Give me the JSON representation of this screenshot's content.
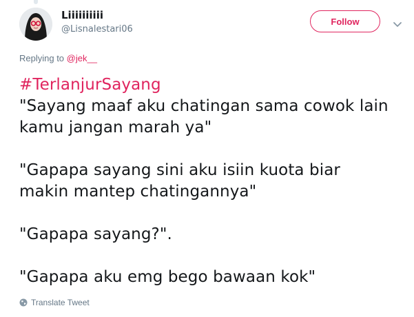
{
  "tweet": {
    "display_name": "Liiiiiiiiii",
    "screen_name": "@Lisnalestari06",
    "follow_label": "Follow",
    "replying_prefix": "Replying to",
    "replying_to": "@jek__",
    "hashtag": "#TerlanjurSayang",
    "lines": [
      "\"Sayang maaf aku chatingan sama cowok lain",
      "kamu jangan marah ya\"",
      "\"Gapapa sayang sini aku isiin kuota biar",
      "makin mantep chatingannya\"",
      "\"Gapapa sayang?\".",
      "\"Gapapa aku emg bego bawaan kok\""
    ],
    "translate_label": "Translate Tweet"
  },
  "icons": {
    "caret": "chevron-down-icon",
    "translate": "globe-icon"
  },
  "colors": {
    "accent": "#e0245e",
    "muted": "#657786",
    "text": "#14171a"
  }
}
